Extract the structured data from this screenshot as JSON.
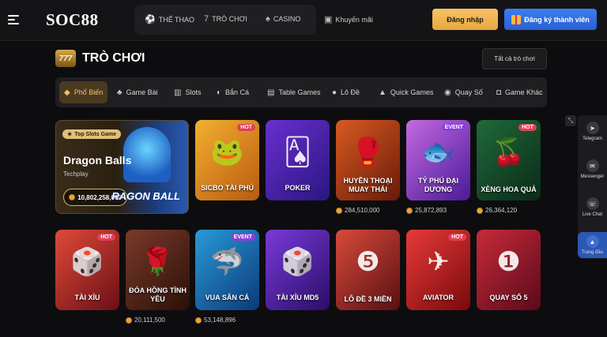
{
  "header": {
    "logo": "SOC88",
    "nav": [
      {
        "icon": "soccer-ball-icon",
        "label": "THỂ THAO"
      },
      {
        "icon": "slot-777-icon",
        "label": "TRÒ CHƠI"
      },
      {
        "icon": "casino-cards-icon",
        "label": "CASINO"
      },
      {
        "icon": "gift-icon",
        "label": "Khuyến mãi"
      }
    ],
    "login_label": "Đăng nhập",
    "register_label": "Đăng ký thành viên"
  },
  "section": {
    "title": "TRÒ CHƠI",
    "view_all_label": "Tất cả trò chơi"
  },
  "tabs": [
    {
      "icon": "flame-icon",
      "label": "Phổ Biến",
      "active": true
    },
    {
      "icon": "cards-icon",
      "label": "Game Bài"
    },
    {
      "icon": "slot-icon",
      "label": "Slots"
    },
    {
      "icon": "fish-icon",
      "label": "Bắn Cá"
    },
    {
      "icon": "table-icon",
      "label": "Table Games"
    },
    {
      "icon": "lottery-icon",
      "label": "Lô Đề"
    },
    {
      "icon": "quick-icon",
      "label": "Quick Games"
    },
    {
      "icon": "draw-icon",
      "label": "Quay Số"
    },
    {
      "icon": "controller-icon",
      "label": "Game Khác"
    }
  ],
  "featured": {
    "badge": "Top Slots Game",
    "name": "Dragon Balls",
    "provider": "Techplay",
    "jackpot": "10,802,258,000",
    "art_text": "RAGON BALL"
  },
  "games_row1": [
    {
      "label": "SICBO TÀI PHÚ",
      "badge": "HOT",
      "count": ""
    },
    {
      "label": "POKER",
      "badge": "",
      "count": ""
    },
    {
      "label": "HUYỀN THOẠI MUAY THÁI",
      "badge": "",
      "count": "284,510,000"
    },
    {
      "label": "TỶ PHÚ ĐẠI DƯƠNG",
      "badge": "EVENT",
      "count": "25,872,893"
    },
    {
      "label": "XÈNG HOA QUẢ",
      "badge": "HOT",
      "count": "26,364,120"
    }
  ],
  "games_row2": [
    {
      "label": "TÀI XỈU",
      "badge": "HOT",
      "count": ""
    },
    {
      "label": "ĐÓA HỒNG TÌNH YÊU",
      "badge": "",
      "count": "20,111,500"
    },
    {
      "label": "VUA SĂN CÁ",
      "badge": "EVENT",
      "count": "53,148,896"
    },
    {
      "label": "TÀI XỈU MD5",
      "badge": "",
      "count": ""
    },
    {
      "label": "LÔ ĐỀ 3 MIỀN",
      "badge": "",
      "count": ""
    },
    {
      "label": "AVIATOR",
      "badge": "HOT",
      "count": ""
    },
    {
      "label": "QUAY SỐ 5",
      "badge": "",
      "count": ""
    }
  ],
  "sidebar": [
    {
      "icon": "telegram-icon",
      "label": "Telegram"
    },
    {
      "icon": "messenger-icon",
      "label": "Messenger"
    },
    {
      "icon": "chat-icon",
      "label": "Live Chat"
    },
    {
      "icon": "arrow-up-icon",
      "label": "Trang đầu"
    }
  ],
  "colors": {
    "accent_gold": "#e8a73f",
    "register_blue": "#2960d4",
    "hot_badge": "#e23e57",
    "event_badge": "#8a3fd9"
  }
}
